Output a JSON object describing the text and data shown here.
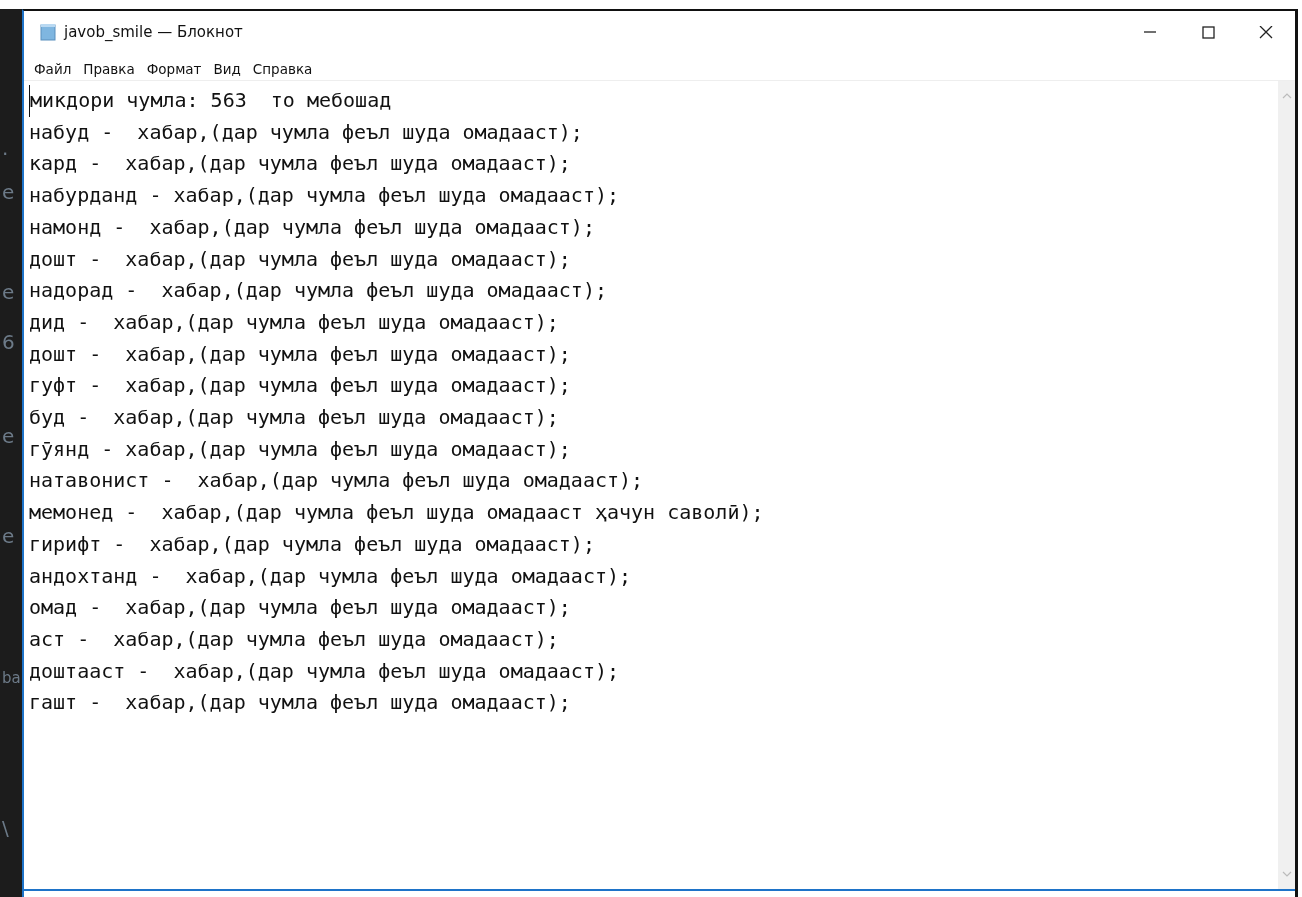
{
  "background_fragments": [
    ".",
    "e",
    "e",
    "6",
    "e",
    "e",
    "ba",
    "\\"
  ],
  "window": {
    "title": "javob_smile — Блокнот",
    "controls": [
      {
        "kind": "minimize"
      },
      {
        "kind": "maximize"
      },
      {
        "kind": "close"
      }
    ]
  },
  "menu": [
    "Файл",
    "Правка",
    "Формат",
    "Вид",
    "Справка"
  ],
  "editor": {
    "lines": [
      "микдори чумла: 563  то мебошад",
      "набуд -  хабар,(дар чумла феъл шуда омадааст);",
      "кард -  хабар,(дар чумла феъл шуда омадааст);",
      "набурданд - хабар,(дар чумла феъл шуда омадааст);",
      "намонд -  хабар,(дар чумла феъл шуда омадааст);",
      "дошт -  хабар,(дар чумла феъл шуда омадааст);",
      "надорад -  хабар,(дар чумла феъл шуда омадааст);",
      "дид -  хабар,(дар чумла феъл шуда омадааст);",
      "дошт -  хабар,(дар чумла феъл шуда омадааст);",
      "гуфт -  хабар,(дар чумла феъл шуда омадааст);",
      "буд -  хабар,(дар чумла феъл шуда омадааст);",
      "гӯянд - хабар,(дар чумла феъл шуда омадааст);",
      "натавонист -  хабар,(дар чумла феъл шуда омадааст);",
      "мемонед -  хабар,(дар чумла феъл шуда омадааст ҳачун саволӣ);",
      "гирифт -  хабар,(дар чумла феъл шуда омадааст);",
      "андохтанд -  хабар,(дар чумла феъл шуда омадааст);",
      "омад -  хабар,(дар чумла феъл шуда омадааст);",
      "аст -  хабар,(дар чумла феъл шуда омадааст);",
      "доштааст -  хабар,(дар чумла феъл шуда омадааст);",
      "гашт -  хабар,(дар чумла феъл шуда омадааст);"
    ]
  }
}
